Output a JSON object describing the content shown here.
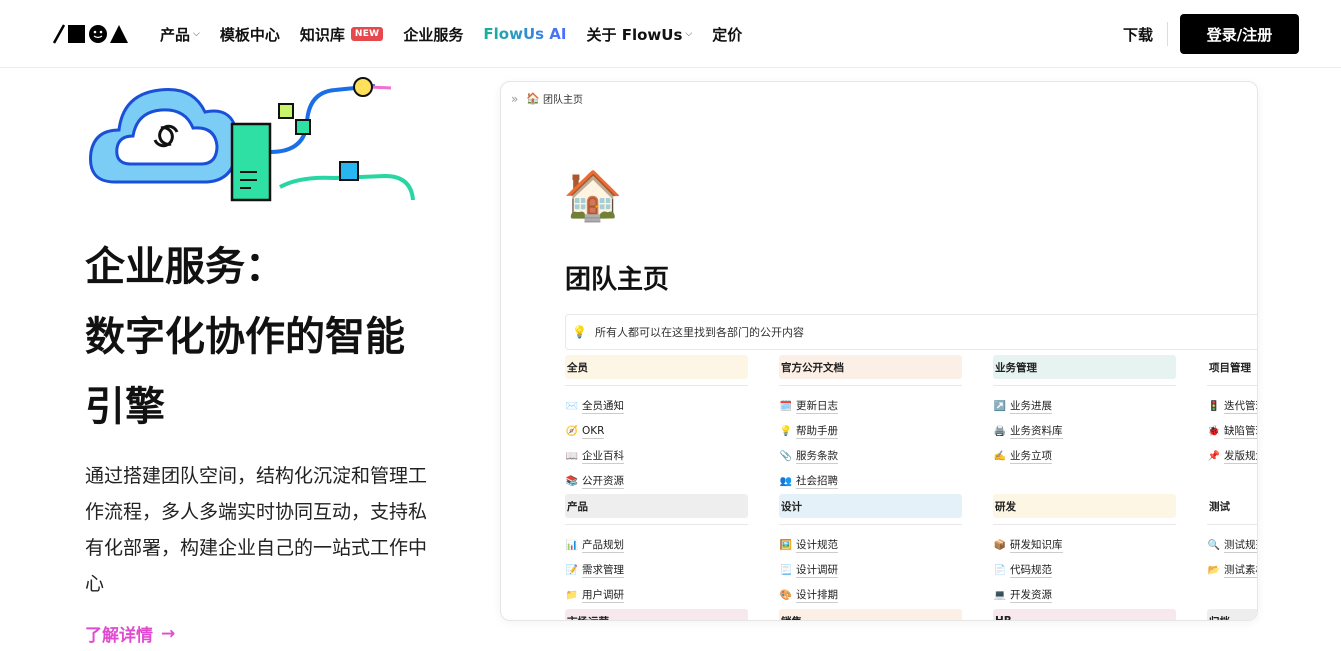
{
  "nav": {
    "items": [
      {
        "label": "产品",
        "has_chevron": true
      },
      {
        "label": "模板中心",
        "has_chevron": false
      },
      {
        "label": "知识库",
        "has_chevron": false,
        "badge": "NEW"
      },
      {
        "label": "企业服务",
        "has_chevron": false
      },
      {
        "label": "FlowUs AI",
        "has_chevron": false
      },
      {
        "label": "关于 FlowUs",
        "has_chevron": true
      },
      {
        "label": "定价",
        "has_chevron": false
      }
    ],
    "download": "下载",
    "login": "登录/注册",
    "chevron": "⌵"
  },
  "hero": {
    "title_line1": "企业服务：",
    "title_line2": "数字化协作的智能",
    "title_line3": "引擎",
    "description": "通过搭建团队空间，结构化沉淀和管理工作流程，多人多端实时协同互动，支持私有化部署，构建企业自己的一站式工作中心",
    "link": "了解详情",
    "link_arrow": "→"
  },
  "preview": {
    "breadcrumb_icon": "»",
    "breadcrumb_page_icon": "🏠",
    "breadcrumb": "团队主页",
    "page_emoji": "🏠",
    "page_title": "团队主页",
    "callout_icon": "💡",
    "callout": "所有人都可以在这里找到各部门的公开内容",
    "columns": [
      {
        "sections": [
          {
            "title": "全员",
            "color": "c-y",
            "items": [
              {
                "icon": "✉️",
                "label": "全员通知"
              },
              {
                "icon": "🧭",
                "label": "OKR"
              },
              {
                "icon": "📖",
                "label": "企业百科"
              },
              {
                "icon": "📚",
                "label": "公开资源"
              }
            ]
          },
          {
            "title": "产品",
            "color": "c-gray",
            "items": [
              {
                "icon": "📊",
                "label": "产品规划"
              },
              {
                "icon": "📝",
                "label": "需求管理"
              },
              {
                "icon": "📁",
                "label": "用户调研"
              }
            ]
          },
          {
            "title": "市场运营",
            "color": "c-p",
            "items": []
          }
        ]
      },
      {
        "sections": [
          {
            "title": "官方公开文档",
            "color": "c-o",
            "items": [
              {
                "icon": "🗓️",
                "label": "更新日志"
              },
              {
                "icon": "💡",
                "label": "帮助手册"
              },
              {
                "icon": "📎",
                "label": "服务条款"
              },
              {
                "icon": "👥",
                "label": "社会招聘"
              }
            ]
          },
          {
            "title": "设计",
            "color": "c-b",
            "items": [
              {
                "icon": "🖼️",
                "label": "设计规范"
              },
              {
                "icon": "📃",
                "label": "设计调研"
              },
              {
                "icon": "🎨",
                "label": "设计排期"
              }
            ]
          },
          {
            "title": "销售",
            "color": "c-o",
            "items": []
          }
        ]
      },
      {
        "sections": [
          {
            "title": "业务管理",
            "color": "c-g",
            "items": [
              {
                "icon": "↗️",
                "label": "业务进展"
              },
              {
                "icon": "🖨️",
                "label": "业务资料库"
              },
              {
                "icon": "✍️",
                "label": "业务立项"
              }
            ]
          },
          {
            "title": "研发",
            "color": "c-y",
            "items": [
              {
                "icon": "📦",
                "label": "研发知识库"
              },
              {
                "icon": "📄",
                "label": "代码规范"
              },
              {
                "icon": "💻",
                "label": "开发资源"
              }
            ]
          },
          {
            "title": "HR",
            "color": "c-p",
            "items": []
          }
        ]
      },
      {
        "sections": [
          {
            "title": "项目管理",
            "color": "c-plain",
            "items": [
              {
                "icon": "🚦",
                "label": "迭代管理"
              },
              {
                "icon": "🐞",
                "label": "缺陷管理"
              },
              {
                "icon": "📌",
                "label": "发版规划"
              }
            ]
          },
          {
            "title": "测试",
            "color": "c-plain",
            "items": [
              {
                "icon": "🔍",
                "label": "测试规范"
              },
              {
                "icon": "📂",
                "label": "测试素材"
              }
            ]
          },
          {
            "title": "归档",
            "color": "c-gray",
            "items": []
          }
        ]
      }
    ]
  }
}
